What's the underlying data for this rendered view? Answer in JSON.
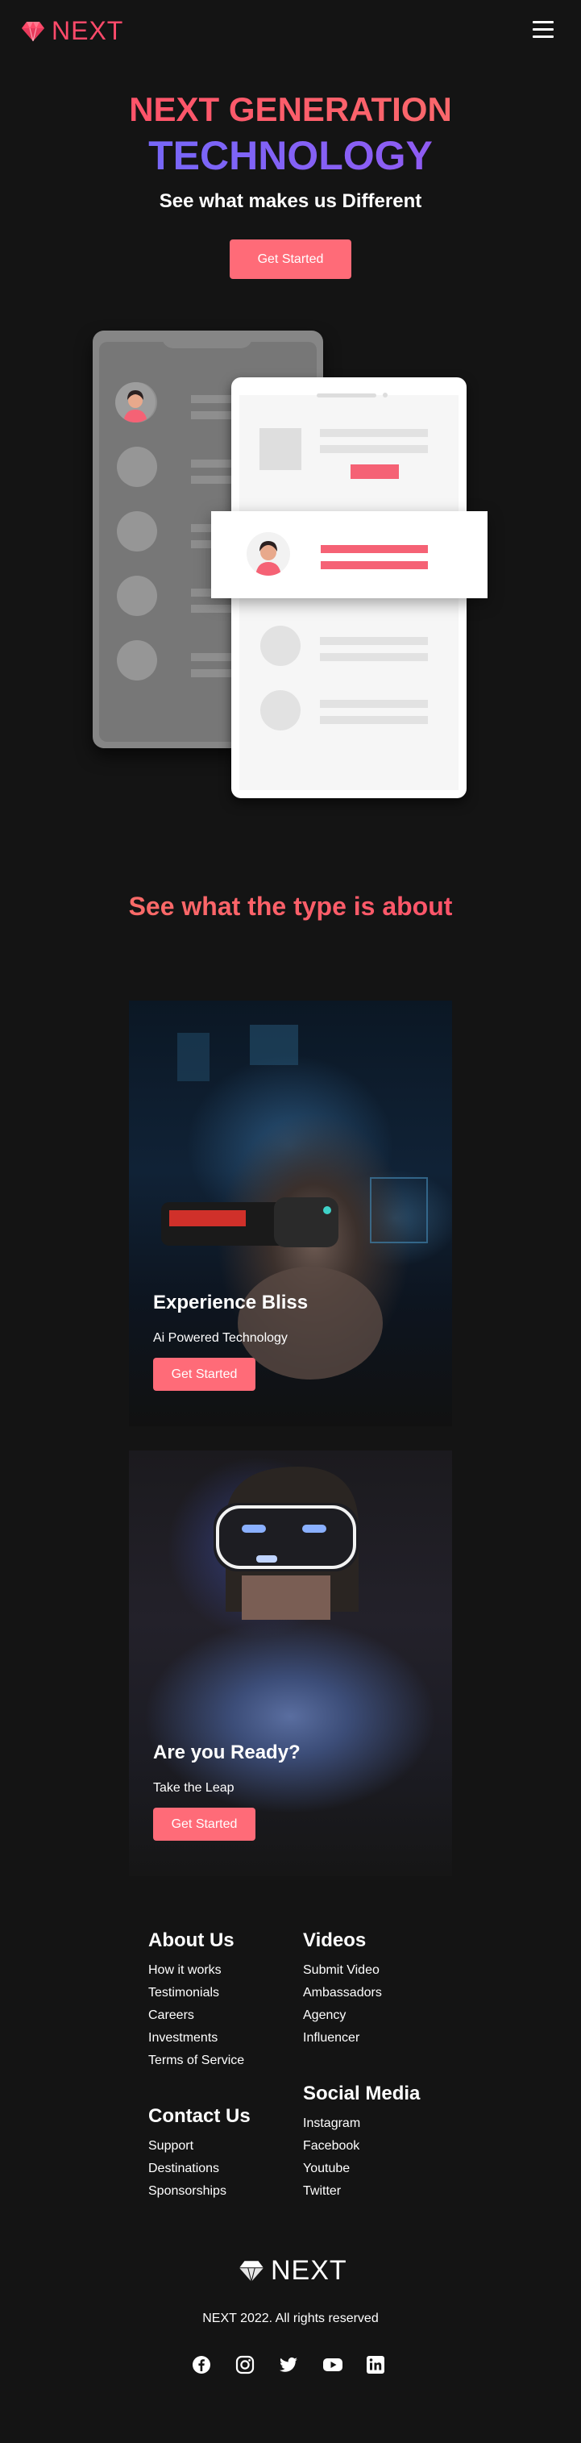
{
  "brand": {
    "name": "NEXT",
    "accent": "#ff4a6a",
    "button_color": "#ff6b78"
  },
  "nav": {
    "menu_icon": "hamburger-menu-icon"
  },
  "hero": {
    "title_line1": "NEXT GENERATION",
    "title_line2": "TECHNOLOGY",
    "subtitle": "See what makes us Different",
    "cta": "Get Started"
  },
  "section": {
    "title": "See what the type is about"
  },
  "cards": [
    {
      "title": "Experience Bliss",
      "text": "Ai Powered Technology",
      "cta": "Get Started"
    },
    {
      "title": "Are you Ready?",
      "text": "Take the Leap",
      "cta": "Get Started"
    }
  ],
  "footer": {
    "about": {
      "heading": "About Us",
      "links": [
        "How it works",
        "Testimonials",
        "Careers",
        "Investments",
        "Terms of Service"
      ]
    },
    "videos": {
      "heading": "Videos",
      "links": [
        "Submit Video",
        "Ambassadors",
        "Agency",
        "Influencer"
      ]
    },
    "contact": {
      "heading": "Contact Us",
      "links": [
        "Support",
        "Destinations",
        "Sponsorships"
      ]
    },
    "social": {
      "heading": "Social Media",
      "links": [
        "Instagram",
        "Facebook",
        "Youtube",
        "Twitter"
      ]
    },
    "logo_text": "NEXT",
    "copyright": "NEXT 2022. All rights reserved",
    "social_icons": [
      "facebook-icon",
      "instagram-icon",
      "twitter-icon",
      "youtube-icon",
      "linkedin-icon"
    ]
  }
}
